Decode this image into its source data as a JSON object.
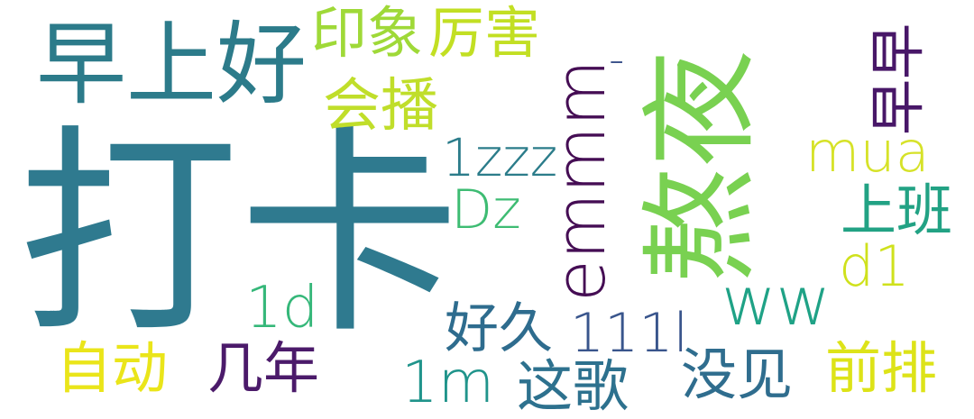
{
  "words": [
    {
      "id": "dk",
      "text": "打卡",
      "color": "#2f7a8f"
    },
    {
      "id": "ao",
      "text": "熬夜",
      "color": "#79d151"
    },
    {
      "id": "zsh",
      "text": "早上好",
      "color": "#2c7b8a"
    },
    {
      "id": "yx",
      "text": "印象",
      "color": "#9fd938"
    },
    {
      "id": "lh",
      "text": "厉害",
      "color": "#c2df23"
    },
    {
      "id": "hb",
      "text": "会播",
      "color": "#c0de2a"
    },
    {
      "id": "zz",
      "text": "早早",
      "color": "#481768"
    },
    {
      "id": "dash",
      "text": "-",
      "color": "#3b528b"
    },
    {
      "id": "zzz",
      "text": "1zzz",
      "color": "#2b7c8a"
    },
    {
      "id": "emmm",
      "text": "emmm",
      "color": "#450d54"
    },
    {
      "id": "mua",
      "text": "mua",
      "color": "#d6e228"
    },
    {
      "id": "sb",
      "text": "上班",
      "color": "#22a284"
    },
    {
      "id": "dz",
      "text": "Dz",
      "color": "#3ebc73"
    },
    {
      "id": "d1",
      "text": "d1",
      "color": "#cfe11c"
    },
    {
      "id": "ww",
      "text": "ww",
      "color": "#1fa286"
    },
    {
      "id": "1d",
      "text": "1d",
      "color": "#35b779"
    },
    {
      "id": "hj",
      "text": "好久",
      "color": "#2e6c8e"
    },
    {
      "id": "111l",
      "text": "111l",
      "color": "#39558c"
    },
    {
      "id": "zd",
      "text": "自动",
      "color": "#eae51a"
    },
    {
      "id": "jn",
      "text": "几年",
      "color": "#4b1a6a"
    },
    {
      "id": "my",
      "text": "没见",
      "color": "#2f6d8e"
    },
    {
      "id": "qp",
      "text": "前排",
      "color": "#dde318"
    },
    {
      "id": "1m",
      "text": "1m",
      "color": "#20948b"
    },
    {
      "id": "zg",
      "text": "这歌",
      "color": "#2d718e"
    }
  ]
}
